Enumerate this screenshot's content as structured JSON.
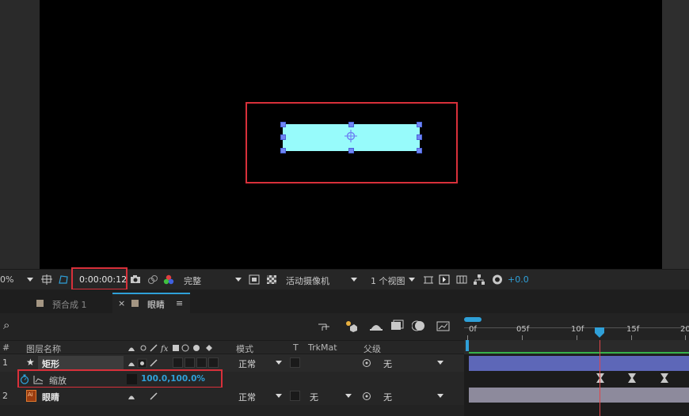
{
  "viewer": {
    "zoom": "0%",
    "timecode": "0:00:00:12",
    "resolution": "完整",
    "camera": "活动摄像机",
    "views": "1 个视图",
    "exposure": "+0.0"
  },
  "tabs": [
    {
      "label": "预合成 1",
      "active": false
    },
    {
      "label": "眼睛",
      "active": true,
      "close": "×",
      "menu": "≡"
    }
  ],
  "search": {
    "icon": "⌕"
  },
  "ruler": {
    "ticks": [
      "0f",
      "05f",
      "10f",
      "15f",
      "20"
    ],
    "current_frame": 12
  },
  "columns": {
    "layer_name": "图层名称",
    "mode": "模式",
    "t": "T",
    "trkmat": "TrkMat",
    "parent": "父级"
  },
  "layers": [
    {
      "index": "1",
      "name": "矩形",
      "mode": "正常",
      "parent": "无",
      "type": "shape"
    },
    {
      "index": "2",
      "name": "眼睛",
      "mode": "正常",
      "trkmat": "无",
      "parent": "无",
      "type": "ai"
    }
  ],
  "property": {
    "name": "缩放",
    "value": "100.0,100.0%"
  },
  "colors": {
    "shape_fill": "#97fbfb",
    "handle": "#6f86f4",
    "highlight": "#d8303a",
    "accent": "#2fa0d8",
    "playhead": "#e0454a",
    "layer1_bar": "#5d67b8",
    "layer2_bar": "#8d8a9c"
  }
}
